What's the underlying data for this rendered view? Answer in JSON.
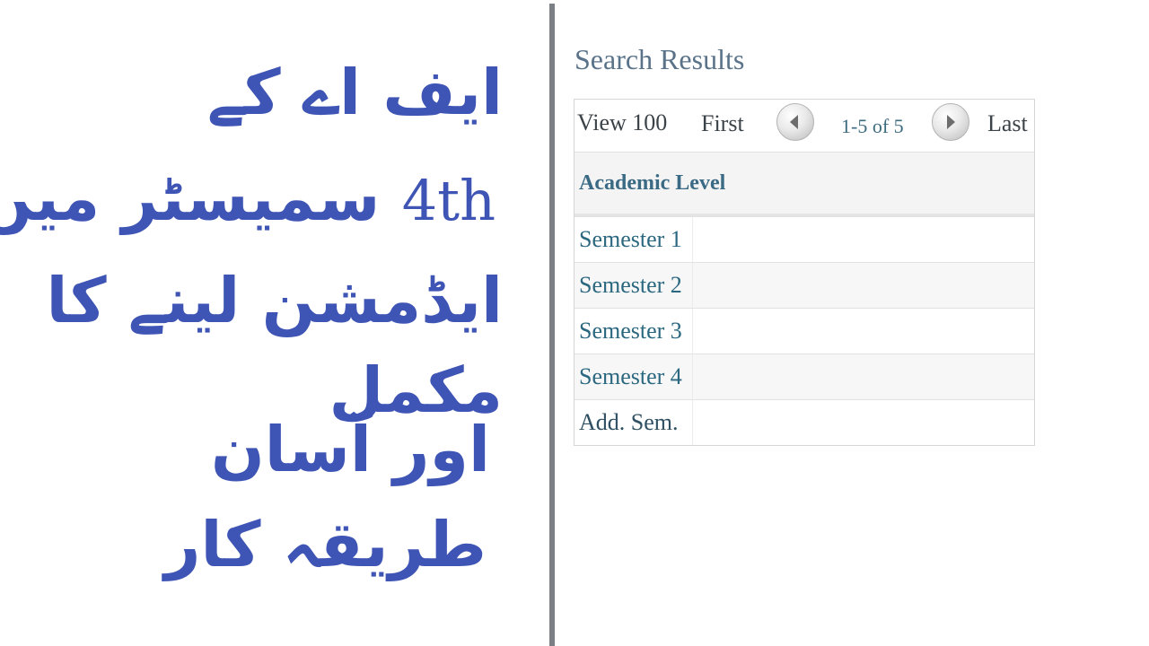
{
  "title_panel": {
    "lines": [
      "ایف اے کے",
      "سمیسٹر میں",
      "ایڈمشن لینے کا",
      "مکمل",
      "اور آسان",
      "طریقہ کار"
    ],
    "ordinal": "4th",
    "text_color": "#3f55b5"
  },
  "search_results": {
    "title": "Search Results",
    "pager": {
      "view_label": "View 100",
      "first_label": "First",
      "prev_icon": "triangle-left-icon",
      "range_text": "1-5 of 5",
      "next_icon": "triangle-right-icon",
      "last_label": "Last"
    },
    "column_header": "Academic Level",
    "rows": [
      "Semester 1",
      "Semester 2",
      "Semester 3",
      "Semester 4",
      "Add. Sem."
    ]
  }
}
